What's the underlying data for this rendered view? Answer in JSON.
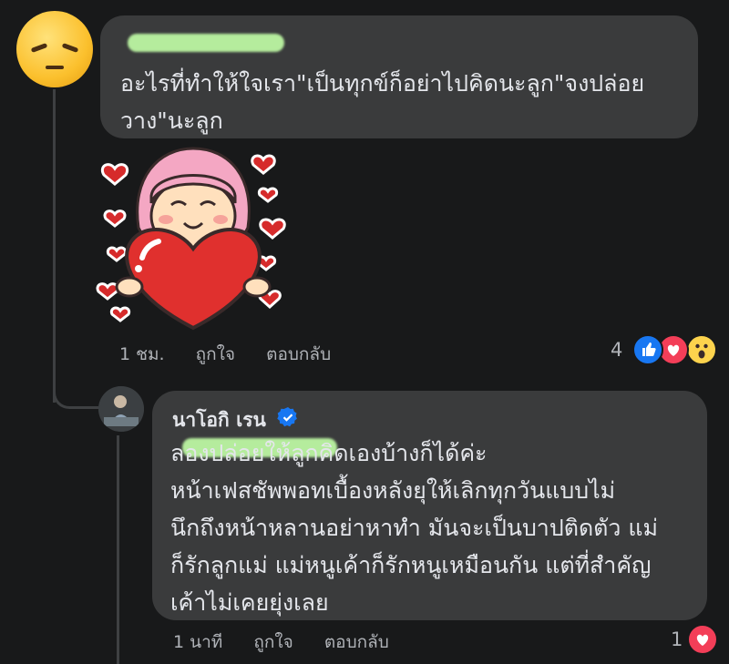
{
  "comment1": {
    "text": "อะไรที่ทำให้ใจเรา\"เป็นทุกข์ก็อย่าไปคิดนะลูก\"จงปล่อย\nวาง\"นะลูก",
    "time": "1 ชม.",
    "like_label": "ถูกใจ",
    "reply_label": "ตอบกลับ",
    "reaction_count": "4",
    "reaction_icons": [
      "like-icon",
      "love-icon",
      "wow-icon"
    ]
  },
  "reply1": {
    "author": "นาโอกิ เรน",
    "text": "ลองปล่อยให้ลูกคิดเองบ้างก็ได้ค่ะ\nหน้าเฟสชัพพอทเบื้องหลังยุให้เลิกทุกวันแบบไม่\nนึกถึงหน้าหลานอย่าหาทำ มันจะเป็นบาปติดตัว แม่\nก็รักลูกแม่ แม่หนูเค้าก็รักหนูเหมือนกัน แต่ที่สำคัญ\nเค้าไม่เคยยุ่งเลย",
    "time": "1 นาที",
    "like_label": "ถูกใจ",
    "reply_label": "ตอบกลับ",
    "reaction_count": "1",
    "reaction_icons": [
      "love-icon"
    ]
  },
  "colors": {
    "background": "#18191a",
    "bubble": "#3a3b3c",
    "text": "#e4e6eb",
    "meta": "#b0b3b8",
    "redaction": "#b5ec9d",
    "like_blue": "#1877f2",
    "love_red": "#f33e58"
  }
}
